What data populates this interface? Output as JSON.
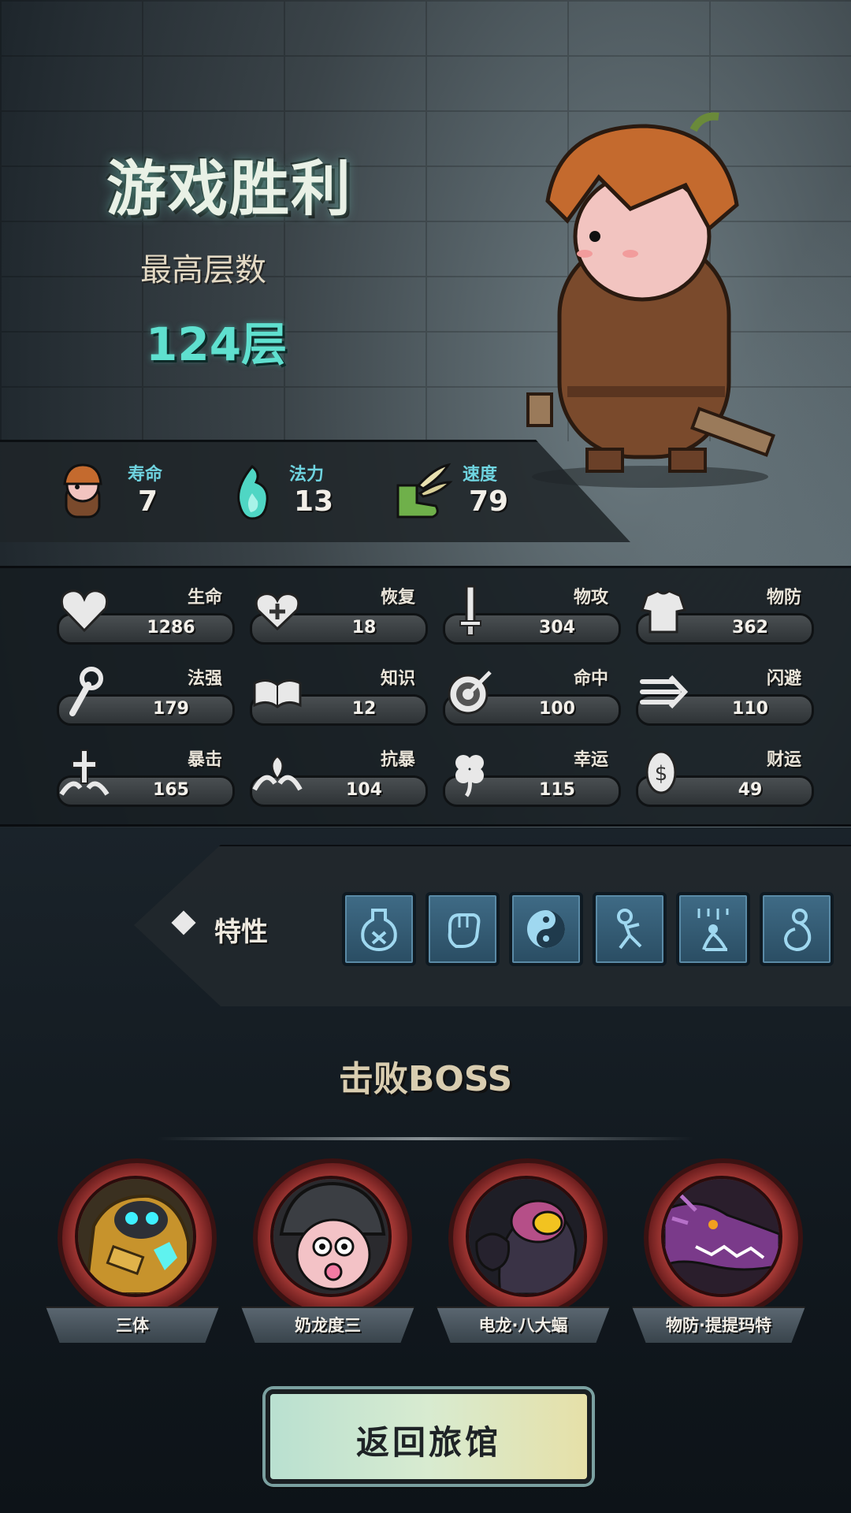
{
  "result": {
    "title": "游戏胜利",
    "floor_label": "最高层数",
    "floor_value": "124层"
  },
  "top_stats": [
    {
      "label": "寿命",
      "value": "7",
      "icon": "hero-head-icon"
    },
    {
      "label": "法力",
      "value": "13",
      "icon": "mana-flame-icon"
    },
    {
      "label": "速度",
      "value": "79",
      "icon": "winged-boot-icon"
    }
  ],
  "attributes": [
    {
      "label": "生命",
      "value": "1286",
      "icon": "heart-icon"
    },
    {
      "label": "恢复",
      "value": "18",
      "icon": "heal-heart-icon"
    },
    {
      "label": "物攻",
      "value": "304",
      "icon": "sword-icon"
    },
    {
      "label": "物防",
      "value": "362",
      "icon": "armor-icon"
    },
    {
      "label": "法强",
      "value": "179",
      "icon": "staff-icon"
    },
    {
      "label": "知识",
      "value": "12",
      "icon": "book-icon"
    },
    {
      "label": "命中",
      "value": "100",
      "icon": "target-icon"
    },
    {
      "label": "闪避",
      "value": "110",
      "icon": "dash-icon"
    },
    {
      "label": "暴击",
      "value": "165",
      "icon": "crit-icon"
    },
    {
      "label": "抗暴",
      "value": "104",
      "icon": "crit-resist-icon"
    },
    {
      "label": "幸运",
      "value": "115",
      "icon": "clover-icon"
    },
    {
      "label": "财运",
      "value": "49",
      "icon": "coin-icon"
    }
  ],
  "traits": {
    "label": "特性",
    "items": [
      "potion-trait-icon",
      "fist-trait-icon",
      "yin-yang-trait-icon",
      "runner-trait-icon",
      "rain-kneel-trait-icon",
      "hug-trait-icon"
    ]
  },
  "bosses": {
    "title": "击败BOSS",
    "items": [
      {
        "name": "三体",
        "portrait": "golden-robot-boss"
      },
      {
        "name": "奶龙度三",
        "portrait": "baby-helmet-boss"
      },
      {
        "name": "电龙·八大蝠",
        "portrait": "dark-bird-boss"
      },
      {
        "name": "物防·提提玛特",
        "portrait": "purple-dragon-boss"
      }
    ]
  },
  "return_button": "返回旅馆",
  "colors": {
    "accent_teal": "#5fe0cf",
    "boss_ring": "#a63a36",
    "button_bg": "#d8ebd0"
  }
}
